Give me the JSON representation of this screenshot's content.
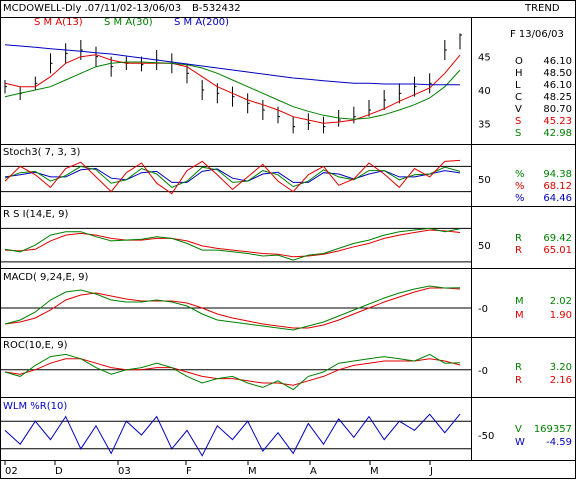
{
  "header": {
    "title": "MCDOWELL-Dly .07/11/02-13/06/03",
    "code": "B-532432",
    "trend": "TREND",
    "sma13": "S M A(13)",
    "sma30": "S M A(30)",
    "sma200": "S M A(200)",
    "date": "F 13/06/03"
  },
  "colors": {
    "price": "#000000",
    "sma13": "#e00000",
    "sma30": "#008000",
    "sma200": "#0000c0",
    "k": "#e00000",
    "d": "#008000",
    "slow": "#0000c0",
    "wlm": "#0000c0"
  },
  "readout": {
    "price": [
      {
        "label": "O",
        "value": "46.10",
        "color": "#000000"
      },
      {
        "label": "H",
        "value": "48.50",
        "color": "#000000"
      },
      {
        "label": "L",
        "value": "46.10",
        "color": "#000000"
      },
      {
        "label": "C",
        "value": "48.25",
        "color": "#000000"
      },
      {
        "label": "V",
        "value": "80.70",
        "color": "#000000"
      },
      {
        "label": "S",
        "value": "45.23",
        "color": "#e00000"
      },
      {
        "label": "S",
        "value": "42.98",
        "color": "#008000"
      }
    ],
    "stoch": [
      {
        "label": "%",
        "value": "94.38",
        "color": "#008000"
      },
      {
        "label": "%",
        "value": "68.12",
        "color": "#e00000"
      },
      {
        "label": "%",
        "value": "64.46",
        "color": "#0000c0"
      }
    ],
    "rsi": [
      {
        "label": "R",
        "value": "69.42",
        "color": "#008000"
      },
      {
        "label": "R",
        "value": "65.01",
        "color": "#e00000"
      }
    ],
    "macd": [
      {
        "label": "M",
        "value": "2.02",
        "color": "#008000"
      },
      {
        "label": "M",
        "value": "1.90",
        "color": "#e00000"
      }
    ],
    "roc": [
      {
        "label": "R",
        "value": "3.20",
        "color": "#008000"
      },
      {
        "label": "R",
        "value": "2.16",
        "color": "#e00000"
      }
    ],
    "wlm": [
      {
        "label": "V",
        "value": "169357",
        "color": "#008000"
      },
      {
        "label": "W",
        "value": "-4.59",
        "color": "#0000c0"
      }
    ]
  },
  "panels": {
    "stoch_title": "Stoch3( 7, 3, 3)",
    "rsi_title": "R S I(14,E, 9)",
    "macd_title": "MACD( 9,24,E, 9)",
    "roc_title": "ROC(10,E, 9)",
    "wlm_title": "WLM %R(10)"
  },
  "chart_data": {
    "type": "line",
    "title": "MCDOWELL-Dly .07/11/02-13/06/03",
    "x_ticks": [
      "02",
      "D",
      "03",
      "F",
      "M",
      "A",
      "M",
      "J"
    ],
    "price_axis_ticks": [
      "45",
      "40",
      "35"
    ],
    "price_ylim": [
      32.5,
      49
    ],
    "price": {
      "x": [
        0,
        4,
        8,
        12,
        16,
        20,
        24,
        28,
        32,
        36,
        40,
        44,
        48,
        52,
        56,
        60,
        64,
        68,
        72,
        76,
        80,
        84,
        88,
        92,
        96,
        100,
        104,
        108,
        112,
        116,
        119
      ],
      "close": [
        40.5,
        39.5,
        41,
        44,
        45.5,
        46,
        45,
        43.5,
        44,
        43.8,
        44.5,
        44,
        42.5,
        40,
        39.5,
        39,
        38,
        37,
        36,
        34.5,
        35,
        34.5,
        35.5,
        36,
        37,
        38.5,
        39.5,
        40.5,
        41,
        46,
        48.25
      ],
      "high": [
        41.5,
        40.5,
        42,
        45.5,
        47,
        47.5,
        46.5,
        45,
        45,
        45,
        46,
        45.5,
        44,
        41.5,
        41,
        40.5,
        39.5,
        38.5,
        37.5,
        36,
        36.5,
        36,
        37,
        37.5,
        38.5,
        40,
        41,
        42,
        42.5,
        47.5,
        48.5
      ],
      "low": [
        39.5,
        38.5,
        40,
        42.5,
        44,
        44.5,
        43.5,
        42,
        43,
        42.8,
        43,
        42.5,
        41,
        38.5,
        38,
        37.5,
        36.5,
        35.5,
        35,
        33.5,
        34,
        33.5,
        34.5,
        35,
        36,
        37,
        38,
        39,
        39.5,
        44.5,
        46.1
      ]
    },
    "series": [
      {
        "name": "S M A(13)",
        "values": [
          41,
          40.5,
          40.5,
          42,
          44,
          45,
          45.3,
          44.5,
          44,
          44,
          44,
          44,
          43.5,
          42,
          40.5,
          39.5,
          38.5,
          37.8,
          37,
          36,
          35.5,
          35,
          35.2,
          35.5,
          36.3,
          37.2,
          38.3,
          39.3,
          40.3,
          42.5,
          45.23
        ]
      },
      {
        "name": "S M A(30)",
        "values": [
          39,
          39.5,
          40,
          40.5,
          41.5,
          42.5,
          43.5,
          44,
          44.2,
          44.2,
          44.1,
          44,
          43.8,
          43.3,
          42.5,
          41.5,
          40.5,
          39.5,
          38.5,
          37.5,
          36.8,
          36.2,
          35.8,
          35.6,
          35.8,
          36.3,
          37,
          37.8,
          38.8,
          40.5,
          42.98
        ]
      },
      {
        "name": "S M A(200)",
        "values": [
          46.8,
          46.6,
          46.4,
          46.2,
          46,
          45.8,
          45.6,
          45.4,
          45.1,
          44.8,
          44.5,
          44.2,
          43.9,
          43.6,
          43.3,
          43,
          42.7,
          42.4,
          42.1,
          41.8,
          41.6,
          41.4,
          41.2,
          41,
          41,
          40.9,
          40.9,
          40.9,
          40.8,
          40.8,
          40.8
        ]
      }
    ],
    "stochastic": {
      "axis_ticks": [
        "50"
      ],
      "k": [
        45,
        80,
        60,
        30,
        75,
        90,
        55,
        20,
        65,
        88,
        40,
        15,
        70,
        92,
        60,
        25,
        55,
        85,
        45,
        20,
        60,
        80,
        35,
        50,
        88,
        62,
        30,
        75,
        55,
        92,
        94.38
      ],
      "d": [
        52,
        65,
        68,
        45,
        58,
        80,
        72,
        40,
        48,
        75,
        62,
        30,
        45,
        78,
        72,
        42,
        45,
        70,
        60,
        32,
        45,
        72,
        55,
        48,
        70,
        70,
        48,
        60,
        62,
        78,
        68.12
      ],
      "slow": [
        55,
        60,
        66,
        55,
        55,
        72,
        75,
        52,
        48,
        65,
        68,
        42,
        42,
        68,
        74,
        52,
        45,
        62,
        66,
        42,
        42,
        65,
        62,
        50,
        62,
        70,
        55,
        55,
        62,
        70,
        64.46
      ]
    },
    "rsi": {
      "axis_ticks": [
        "50"
      ],
      "values": [
        45,
        42,
        50,
        62,
        66,
        66,
        60,
        55,
        56,
        57,
        60,
        58,
        52,
        44,
        44,
        42,
        40,
        37,
        38,
        32,
        38,
        40,
        46,
        52,
        56,
        62,
        66,
        68,
        70,
        66,
        69.42
      ],
      "signal": [
        44,
        43,
        45,
        55,
        62,
        64,
        62,
        58,
        56,
        56,
        58,
        58,
        55,
        49,
        46,
        44,
        42,
        40,
        39,
        36,
        37,
        39,
        43,
        48,
        52,
        58,
        62,
        65,
        68,
        67,
        65.01
      ]
    },
    "macd": {
      "axis_ticks": [
        "-0"
      ],
      "values": [
        -1.6,
        -1.2,
        -0.4,
        0.8,
        1.6,
        1.8,
        1.4,
        0.8,
        0.6,
        0.6,
        0.8,
        0.6,
        0.2,
        -0.6,
        -1.2,
        -1.4,
        -1.6,
        -1.8,
        -2,
        -2.2,
        -1.8,
        -1.4,
        -0.8,
        -0.2,
        0.4,
        1,
        1.5,
        1.9,
        2.2,
        2,
        2.02
      ],
      "signal": [
        -1.6,
        -1.4,
        -1,
        -0.2,
        0.8,
        1.3,
        1.5,
        1.2,
        0.9,
        0.7,
        0.7,
        0.7,
        0.5,
        0,
        -0.6,
        -1,
        -1.3,
        -1.6,
        -1.8,
        -2,
        -2,
        -1.7,
        -1.2,
        -0.6,
        0,
        0.6,
        1.1,
        1.6,
        2,
        2,
        1.9
      ]
    },
    "roc": {
      "axis_ticks": [
        "-0"
      ],
      "values": [
        -1,
        -3,
        2,
        6,
        7,
        5,
        1,
        -2,
        0,
        1,
        3,
        1,
        -3,
        -6,
        -4,
        -3,
        -6,
        -8,
        -5,
        -9,
        -3,
        -1,
        3,
        4,
        5,
        6,
        5,
        4,
        7,
        3,
        3.2
      ],
      "signal": [
        -1,
        -2,
        0,
        3,
        5,
        5,
        3,
        1,
        0,
        0,
        1,
        1,
        -1,
        -3,
        -4,
        -4,
        -5,
        -6,
        -6,
        -7,
        -5,
        -3,
        0,
        2,
        3,
        4,
        4,
        4,
        5,
        4,
        2.16
      ]
    },
    "wlm": {
      "axis_ticks": [
        "-50"
      ],
      "values": [
        -40,
        -70,
        -20,
        -60,
        -10,
        -80,
        -30,
        -90,
        -20,
        -50,
        -10,
        -80,
        -40,
        -95,
        -30,
        -60,
        -20,
        -85,
        -45,
        -90,
        -25,
        -70,
        -15,
        -55,
        -10,
        -60,
        -20,
        -40,
        -5,
        -45,
        -4.59
      ]
    }
  }
}
